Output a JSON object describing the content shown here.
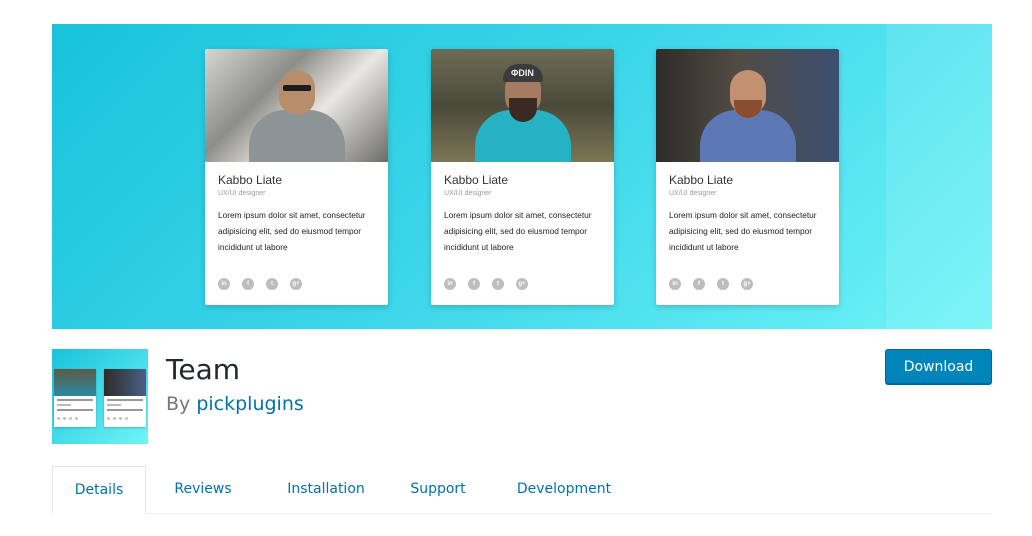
{
  "banner": {
    "cards": [
      {
        "name": "Kabbo Liate",
        "role": "UX/UI designer",
        "description": "Lorem ipsum dolor sit amet, consectetur adipisicing elit, sed do eiusmod tempor incididunt ut labore",
        "socials": [
          "in",
          "f",
          "t",
          "g+"
        ]
      },
      {
        "name": "Kabbo Liate",
        "role": "UX/UI designer",
        "description": "Lorem ipsum dolor sit amet, consectetur adipisicing elit, sed do eiusmod tempor incididunt ut labore",
        "beanie_text": "ΦDIN",
        "socials": [
          "in",
          "f",
          "t",
          "g+"
        ]
      },
      {
        "name": "Kabbo Liate",
        "role": "UX/UI designer",
        "description": "Lorem ipsum dolor sit amet, consectetur adipisicing elit, sed do eiusmod tempor incididunt ut labore",
        "socials": [
          "in",
          "f",
          "t",
          "g+"
        ]
      }
    ]
  },
  "plugin": {
    "title": "Team",
    "by_prefix": "By",
    "author": "pickplugins",
    "download_label": "Download"
  },
  "tabs": [
    {
      "label": "Details",
      "active": true
    },
    {
      "label": "Reviews",
      "active": false
    },
    {
      "label": "Installation",
      "active": false
    },
    {
      "label": "Support",
      "active": false
    },
    {
      "label": "Development",
      "active": false
    }
  ],
  "colors": {
    "accent": "#0073aa",
    "button": "#0085ba",
    "banner_start": "#18c3da",
    "banner_end": "#6ff4f7"
  }
}
